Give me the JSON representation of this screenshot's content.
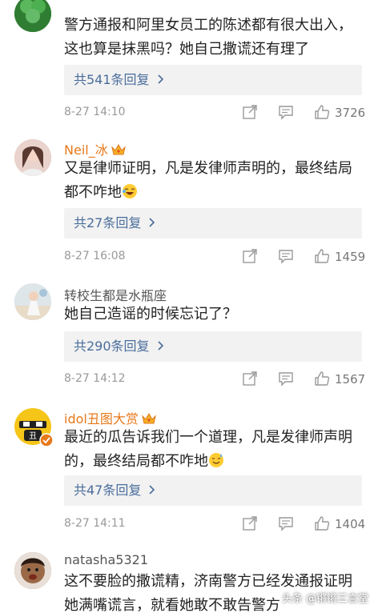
{
  "comments": [
    {
      "username": "",
      "text": "警方通报和阿里女员工的陈述都有很大出入，这也算是抹黑吗？她自己撒谎还有理了",
      "replies_label": "共541条回复",
      "time": "8-27 14:10",
      "likes": "3726",
      "avatar_color": "#3a8a3a"
    },
    {
      "username": "Neil_冰",
      "text": "又是律师证明，凡是发律师声明的，最终结局都不咋地",
      "replies_label": "共27条回复",
      "time": "8-27 16:08",
      "likes": "1459",
      "avatar_color": "#d9b4a8"
    },
    {
      "username": "转校生都是水瓶座",
      "text": "她自己造谣的时候忘记了？",
      "replies_label": "共290条回复",
      "time": "8-27 14:12",
      "likes": "1567",
      "avatar_color": "#c8d4dc"
    },
    {
      "username": "idol丑图大赏",
      "text": "最近的瓜告诉我们一个道理，凡是发律师声明的，最终结局都不咋地",
      "replies_label": "共47条回复",
      "time": "8-27 14:11",
      "likes": "1404",
      "avatar_color": "#f5c518"
    },
    {
      "username": "natasha5321",
      "text": "这不要脸的撒谎精，济南警方已经发通报证明她满嘴谎言，就看她敢不敢告警方",
      "avatar_color": "#8a5a3a"
    }
  ],
  "watermark": "头条 @锵锵三言堂",
  "colors": {
    "reply_link": "#4a6d9c",
    "vip_name": "#e8791a",
    "meta": "#999999"
  },
  "icons": [
    "share-icon",
    "comment-icon",
    "like-icon",
    "crown-badge-icon",
    "verified-badge-icon"
  ]
}
